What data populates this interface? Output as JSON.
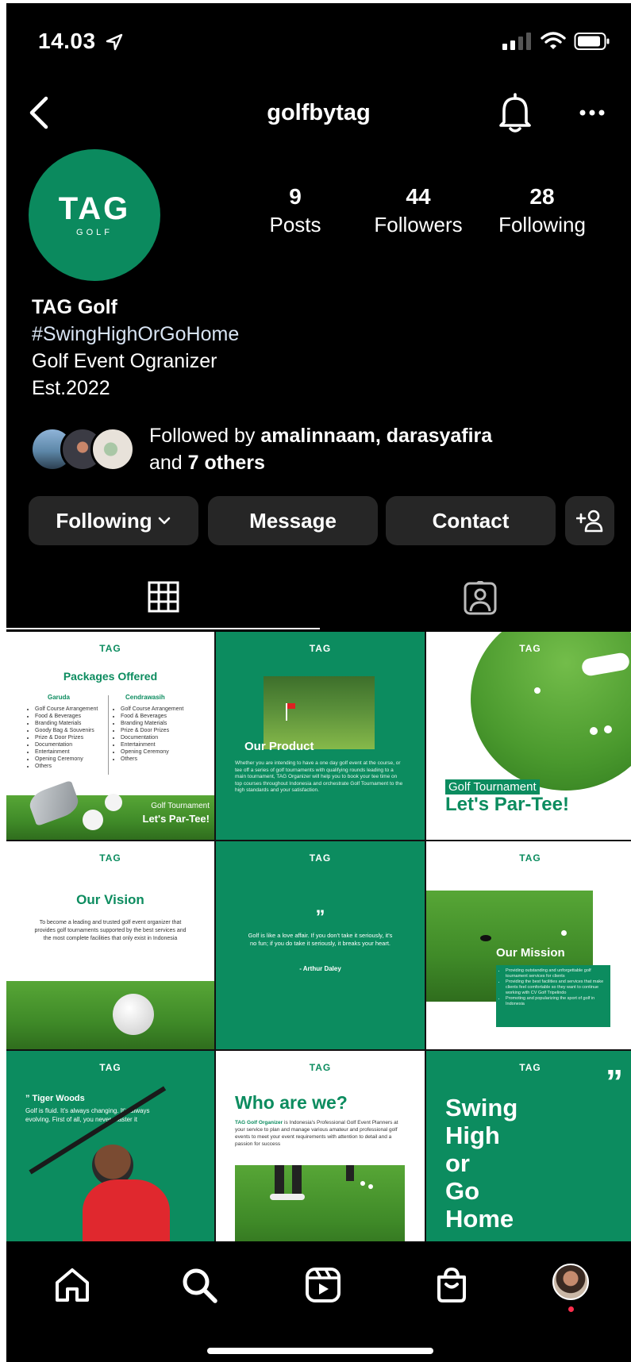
{
  "status": {
    "time": "14.03"
  },
  "header": {
    "title": "golfbytag"
  },
  "profile": {
    "logo_text": "TAG",
    "logo_sub": "GOLF",
    "stats": [
      {
        "value": "9",
        "label": "Posts"
      },
      {
        "value": "44",
        "label": "Followers"
      },
      {
        "value": "28",
        "label": "Following"
      }
    ],
    "name": "TAG Golf",
    "bio": [
      "#SwingHighOrGoHome",
      "Golf Event Ogranizer",
      "Est.2022"
    ],
    "followed_by": {
      "prefix": "Followed by ",
      "users": "amalinnaam, darasyafira",
      "and": "and ",
      "others": "7 others"
    }
  },
  "actions": {
    "following": "Following",
    "message": "Message",
    "contact": "Contact"
  },
  "posts": {
    "p1": {
      "logo": "TAG",
      "title": "Packages Offered",
      "col1_title": "Garuda",
      "col2_title": "Cendrawasih",
      "col1": [
        "Golf Course Arrangement",
        "Food & Beverages",
        "Branding Materials",
        "Goody Bag & Souvenirs",
        "Prize & Door Prizes",
        "Documentation",
        "Entertainment",
        "Opening Ceremony",
        "Others"
      ],
      "col2": [
        "Golf Course Arrangement",
        "Food & Beverages",
        "Branding Materials",
        "Prize & Door Prizes",
        "Documentation",
        "Entertainment",
        "Opening Ceremony",
        "Others"
      ],
      "tag_small": "Golf Tournament",
      "tag_big": "Let's Par-Tee!"
    },
    "p2": {
      "logo": "TAG",
      "title": "Our Product",
      "text": "Whether you are intending to have a one day golf event at the course, or tee off a series of golf tournaments with qualifying rounds leading to a main tournament, TAG Organizer will help you to book your tee time on top courses throughout Indonesia and orchestrate Golf Tournament to the high standards and your satisfaction."
    },
    "p3": {
      "logo": "TAG",
      "small": "Golf Tournament",
      "big": "Let's Par-Tee!"
    },
    "p4": {
      "logo": "TAG",
      "title": "Our Vision",
      "text": "To become a leading and trusted golf event organizer that provides golf tournaments supported by the best services and the most complete facilities that only exist in Indonesia"
    },
    "p5": {
      "logo": "TAG",
      "quote_mark": "”",
      "text": "Golf is like a love affair. If you don't take it seriously, it's no fun; if you do take it seriously, it breaks your heart.",
      "author": "- Arthur Daley"
    },
    "p6": {
      "logo": "TAG",
      "title": "Our Mission",
      "items": [
        "Providing outstanding and unforgettable golf tournament services for clients",
        "Providing the best facilities and services that make clients feel comfortable so they want to continue working with CV Golf Tripelindo",
        "Promoting and popularizing the sport of golf in Indonesia"
      ]
    },
    "p7": {
      "logo": "TAG",
      "title": "” Tiger Woods",
      "text": "Golf is fluid. It's always changing. It's always evolving. First of all, you never master it"
    },
    "p8": {
      "logo": "TAG",
      "title": "Who are we?",
      "lead": "TAG Golf Organizer",
      "text": " is Indonesia's Professional Golf Event Planners at your service to plan and manage various amateur and professional golf events to meet your event requirements with attention to detail and a passion for success"
    },
    "p9": {
      "logo": "TAG",
      "quote_mark": "”",
      "lines": [
        "Swing",
        "High",
        "or",
        "Go",
        "Home"
      ]
    }
  },
  "colors": {
    "brand_green": "#0c8c5f",
    "background": "#000000",
    "button_bg": "#262626"
  },
  "nav": {
    "icons": [
      "home-icon",
      "search-icon",
      "reels-icon",
      "shop-icon",
      "profile-avatar"
    ]
  }
}
